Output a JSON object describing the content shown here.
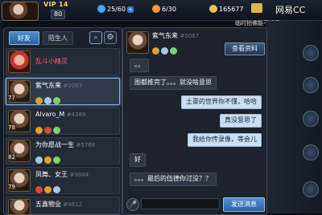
{
  "topbar": {
    "vip": "VIP 14",
    "level": "80",
    "stamina": "25/60",
    "energy": "6/30",
    "coins": "165677",
    "notice": "临时拍佛能不知乎",
    "brand": "网易CC"
  },
  "left": {
    "tabs": [
      "好友",
      "陌生人"
    ],
    "friends": [
      {
        "name": "乱斗小精灵",
        "id": "",
        "level": ""
      },
      {
        "name": "紫气东来",
        "id": "#0067",
        "level": "77"
      },
      {
        "name": "Alvaro_M",
        "id": "#4389",
        "level": "78"
      },
      {
        "name": "为你愿战一生",
        "id": "#5768",
        "level": "82"
      },
      {
        "name": "凤舞、女王",
        "id": "#9844",
        "level": "79"
      },
      {
        "name": "五鑫物业",
        "id": "#4612",
        "level": ""
      }
    ]
  },
  "chat": {
    "name": "紫气东来",
    "id": "#0067",
    "view_profile": "查看资料",
    "messages": [
      {
        "text": "。。",
        "dir": "in"
      },
      {
        "text": "图都推完了。。。就没啥意思",
        "dir": "in"
      },
      {
        "text": "土豪的世界你不懂，哈哈",
        "dir": "out"
      },
      {
        "text": "真没意思了",
        "dir": "out"
      },
      {
        "text": "我给你传录像，等会儿",
        "dir": "out"
      },
      {
        "text": "好",
        "dir": "in"
      },
      {
        "text": "。。。最后的伍德你过没？？",
        "dir": "in"
      }
    ],
    "input_placeholder": "",
    "send": "发送消息"
  },
  "colors": {
    "accent": "#4a8fd1",
    "sprite": "#ff5f7a"
  }
}
